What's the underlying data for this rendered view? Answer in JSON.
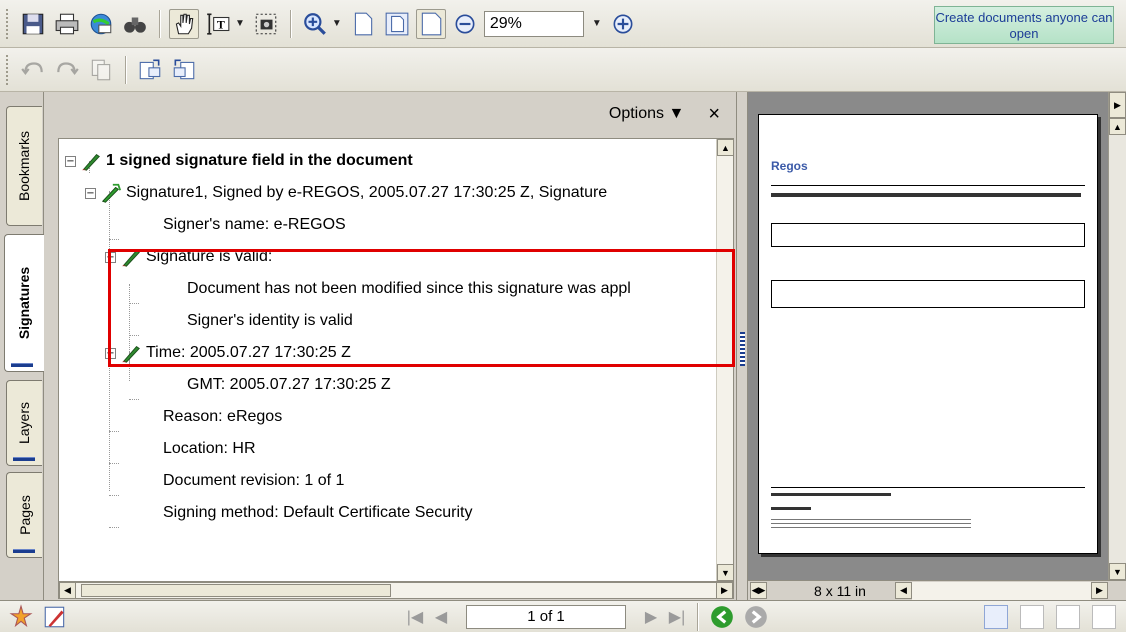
{
  "toolbar": {
    "zoom_value": "29%",
    "promo_text": "Create documents anyone can open",
    "icons": [
      "save-icon",
      "print-icon",
      "email-icon",
      "search-icon",
      "hand-tool-icon",
      "select-text-icon",
      "snapshot-icon",
      "zoom-in-icon",
      "actual-size-icon",
      "fit-page-icon",
      "fit-width-icon",
      "zoom-out-icon",
      "zoom-plus-icon"
    ],
    "icons_row2": [
      "undo-icon",
      "redo-icon",
      "copy-icon",
      "rotate-clockwise-icon",
      "rotate-counterclockwise-icon"
    ]
  },
  "side_tabs": [
    "Bookmarks",
    "Signatures",
    "Layers",
    "Pages"
  ],
  "signatures_panel": {
    "options_label": "Options ▼",
    "close_label": "×",
    "tree": {
      "root": "1 signed signature field in the document",
      "signature": "Signature1, Signed by e-REGOS, 2005.07.27 17:30:25 Z, Signature",
      "signer_name": "Signer's name: e-REGOS",
      "validity_header": "Signature is valid:",
      "not_modified": "Document has not been modified since this signature was appl",
      "identity_valid": "Signer's identity is valid",
      "time": "Time: 2005.07.27 17:30:25 Z",
      "gmt": "GMT: 2005.07.27 17:30:25 Z",
      "reason": "Reason: eRegos",
      "location": "Location: HR",
      "revision": "Document revision: 1 of 1",
      "method": "Signing method: Default Certificate Security"
    }
  },
  "doc_view": {
    "page_logo": "Regos",
    "page_size": "8 x 11 in"
  },
  "statusbar": {
    "page_indicator": "1 of 1"
  },
  "colors": {
    "highlight": "#e00000",
    "promo_bg": "#b5e2c7",
    "promo_text": "#1c3d97"
  }
}
